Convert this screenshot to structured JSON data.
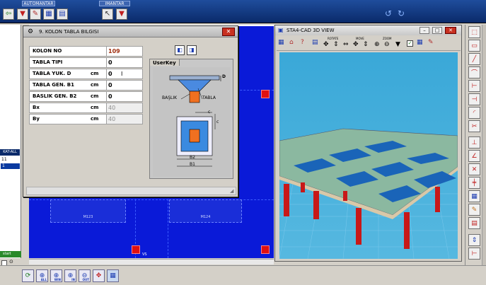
{
  "toolbar": {
    "group_auto": "AUTOMANTAR",
    "group_imantar": "IMANTAR"
  },
  "left_panel": {
    "header": "KAT-ALL",
    "items": [
      "11",
      "1"
    ],
    "start_label": "start"
  },
  "canvas": {
    "slab_labels": [
      "M123",
      "M124"
    ],
    "corner_label": "VS"
  },
  "dialog": {
    "title": "9. KOLON TABLA BILGISI",
    "rows": [
      {
        "label": "KOLON NO",
        "unit": "",
        "value": "109",
        "readonly": false
      },
      {
        "label": "TABLA TIPI",
        "unit": "",
        "value": "0",
        "readonly": false
      },
      {
        "label": "TABLA YUK. D",
        "unit": "cm",
        "value": "0",
        "readonly": false
      },
      {
        "label": "TABLA GEN. B1",
        "unit": "cm",
        "value": "0",
        "readonly": false
      },
      {
        "label": "BASLIK GEN. B2",
        "unit": "cm",
        "value": "0",
        "readonly": false
      },
      {
        "label": "Bx",
        "unit": "cm",
        "value": "40",
        "readonly": true
      },
      {
        "label": "By",
        "unit": "cm",
        "value": "40",
        "readonly": true
      }
    ],
    "userkey_tab": "UserKey",
    "diagram": {
      "label_baslik": "BAŞLIK",
      "label_tabla": "TABLA",
      "label_d": "D",
      "label_c": "c",
      "label_b2": "B2",
      "label_b1": "B1"
    }
  },
  "view3d": {
    "title": "STA4-CAD  3D VIEW",
    "tool_captions": [
      "ROTATE",
      "MOVE",
      "ZOOM"
    ]
  },
  "bottom": {
    "zoom_captions": [
      "ALL",
      "WIN",
      "IN",
      "OUT"
    ]
  }
}
